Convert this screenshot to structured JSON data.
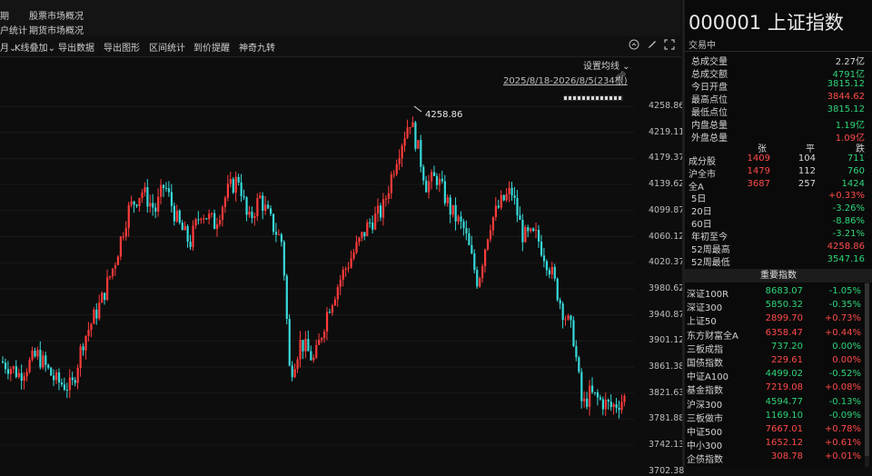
{
  "menu": {
    "row1": [
      "期",
      "股票市场概况"
    ],
    "row2": [
      "户统计",
      "期货市场概况"
    ]
  },
  "toolbar": {
    "items": [
      "月",
      "K线叠加",
      "导出数据",
      "导出图形",
      "区间统计",
      "到价提醒",
      "神奇九转"
    ],
    "icons": [
      "info-circle-icon",
      "brush-icon",
      "expand-icon"
    ]
  },
  "chart": {
    "ma_setting": "设置均线",
    "range_label": "2025/8/18-2026/8/5(234根)",
    "high_marker": "4258.86",
    "y_ticks": [
      "4258.86",
      "4219.11",
      "4179.37",
      "4139.62",
      "4099.87",
      "4060.12",
      "4020.37",
      "3980.62",
      "3940.87",
      "3901.12",
      "3861.38",
      "3821.63",
      "3781.88",
      "3742.13",
      "3702.38"
    ],
    "colors": {
      "up": "#ff3b3b",
      "down": "#38d9d9",
      "bg": "#0d0d0d"
    }
  },
  "chart_data": {
    "type": "candlestick",
    "ylim": [
      3702.38,
      4258.86
    ],
    "high": 4258.86,
    "candles": []
  },
  "quote": {
    "code_name": "000001 上证指数",
    "status": "交易中",
    "fields": [
      {
        "label": "总成交量",
        "value": "2.27亿",
        "color": "white"
      },
      {
        "label": "总成交额",
        "value": "4791亿",
        "color": "green"
      },
      {
        "label": "今日开盘",
        "value": "3815.12",
        "color": "green"
      },
      {
        "label": "最高点位",
        "value": "3844.62",
        "color": "red"
      },
      {
        "label": "最低点位",
        "value": "3815.12",
        "color": "green"
      },
      {
        "label": "内盘总量",
        "value": "1.19亿",
        "color": "green"
      },
      {
        "label": "外盘总量",
        "value": "1.09亿",
        "color": "red"
      }
    ],
    "breadth_header": [
      "张",
      "平",
      "跌"
    ],
    "breadth": [
      {
        "label": "成分股",
        "up": "1409",
        "flat": "104",
        "down": "711"
      },
      {
        "label": "沪全市",
        "up": "1479",
        "flat": "112",
        "down": "760"
      },
      {
        "label": "全A",
        "up": "3687",
        "flat": "257",
        "down": "1424"
      }
    ],
    "periods": [
      {
        "label": "5日",
        "value": "+0.33%",
        "color": "red"
      },
      {
        "label": "20日",
        "value": "-3.26%",
        "color": "green"
      },
      {
        "label": "60日",
        "value": "-8.86%",
        "color": "green"
      },
      {
        "label": "年初至今",
        "value": "-3.21%",
        "color": "green"
      },
      {
        "label": "52周最高",
        "value": "4258.86",
        "color": "red"
      },
      {
        "label": "52周最低",
        "value": "3547.16",
        "color": "green"
      }
    ]
  },
  "indices": {
    "title": "重要指数",
    "rows": [
      {
        "name": "深证100R",
        "price": "8683.07",
        "chg": "-1.05%",
        "color": "green"
      },
      {
        "name": "深证300",
        "price": "5850.32",
        "chg": "-0.35%",
        "color": "green"
      },
      {
        "name": "上证50",
        "price": "2899.70",
        "chg": "+0.73%",
        "color": "red"
      },
      {
        "name": "东方财富全A",
        "price": "6358.47",
        "chg": "+0.44%",
        "color": "red"
      },
      {
        "name": "三板成指",
        "price": "737.20",
        "chg": "0.00%",
        "color": "green"
      },
      {
        "name": "国债指数",
        "price": "229.61",
        "chg": "0.00%",
        "color": "red"
      },
      {
        "name": "中证A100",
        "price": "4499.02",
        "chg": "-0.52%",
        "color": "green"
      },
      {
        "name": "基金指数",
        "price": "7219.08",
        "chg": "+0.08%",
        "color": "red"
      },
      {
        "name": "沪深300",
        "price": "4594.77",
        "chg": "-0.13%",
        "color": "green"
      },
      {
        "name": "三板做市",
        "price": "1169.10",
        "chg": "-0.09%",
        "color": "green"
      },
      {
        "name": "中证500",
        "price": "7667.01",
        "chg": "+0.78%",
        "color": "red"
      },
      {
        "name": "中小300",
        "price": "1652.12",
        "chg": "+0.61%",
        "color": "red"
      },
      {
        "name": "企债指数",
        "price": "308.78",
        "chg": "+0.01%",
        "color": "red"
      }
    ]
  }
}
